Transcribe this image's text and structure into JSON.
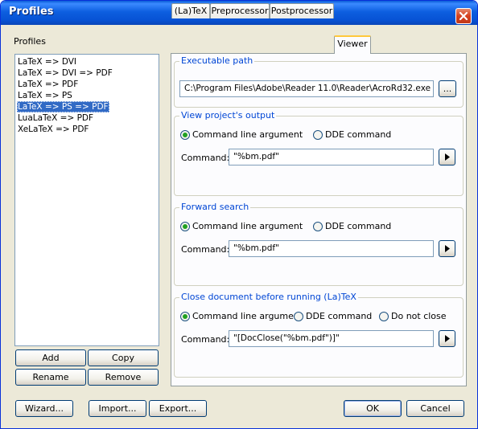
{
  "window": {
    "title": "Profiles"
  },
  "profiles": {
    "label": "Profiles",
    "items": [
      {
        "label": "LaTeX => DVI",
        "selected": false
      },
      {
        "label": "LaTeX => DVI => PDF",
        "selected": false
      },
      {
        "label": "LaTeX => PDF",
        "selected": false
      },
      {
        "label": "LaTeX => PS",
        "selected": false
      },
      {
        "label": "LaTeX => PS => PDF",
        "selected": true
      },
      {
        "label": "LuaLaTeX => PDF",
        "selected": false
      },
      {
        "label": "XeLaTeX => PDF",
        "selected": false
      }
    ],
    "buttons": {
      "add": "Add",
      "copy": "Copy",
      "rename": "Rename",
      "remove": "Remove"
    }
  },
  "tabs": [
    {
      "label": "(La)TeX",
      "active": false
    },
    {
      "label": "Preprocessor",
      "active": false
    },
    {
      "label": "Postprocessor",
      "active": false
    },
    {
      "label": "Viewer",
      "active": true
    }
  ],
  "viewer": {
    "executable": {
      "group_title": "Executable path",
      "value": "C:\\Program Files\\Adobe\\Reader 11.0\\Reader\\AcroRd32.exe",
      "browse_label": "..."
    },
    "view_output": {
      "group_title": "View project's output",
      "radio_cmd": "Command line argument",
      "radio_dde": "DDE command",
      "selected": "cmd",
      "command_label": "Command:",
      "command_value": "\"%bm.pdf\""
    },
    "forward_search": {
      "group_title": "Forward search",
      "radio_cmd": "Command line argument",
      "radio_dde": "DDE command",
      "selected": "cmd",
      "command_label": "Command:",
      "command_value": "\"%bm.pdf\""
    },
    "close_document": {
      "group_title": "Close document before running (La)TeX",
      "radio_cmd": "Command line argument",
      "radio_dde": "DDE command",
      "radio_none": "Do not close",
      "selected": "cmd",
      "command_label": "Command:",
      "command_value": "\"[DocClose(\"%bm.pdf\")]\""
    }
  },
  "footer": {
    "wizard": "Wizard...",
    "import": "Import...",
    "export": "Export...",
    "ok": "OK",
    "cancel": "Cancel"
  },
  "colors": {
    "titlebar": "#0a5bd6",
    "selection": "#316ac5",
    "group_title": "#0046d5",
    "active_tab_accent": "#ffc83c",
    "close_button": "#d5411e"
  }
}
